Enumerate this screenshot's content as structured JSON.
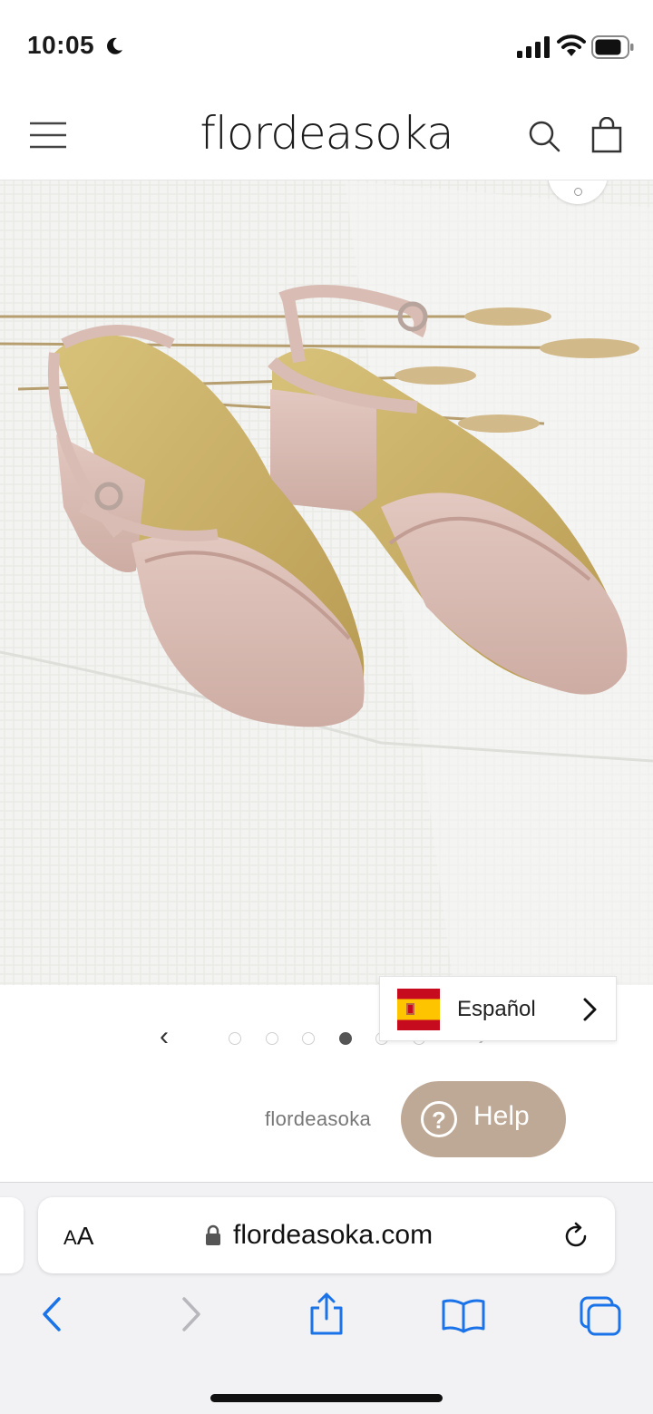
{
  "status_bar": {
    "time": "10:05"
  },
  "header": {
    "brand": "flordeasoka"
  },
  "product": {
    "image_alt": "Pink suede block-heel sandals with ankle straps on a white woven blanket with wheat stalks",
    "carousel": {
      "total_dots": 6,
      "active_index": 3
    }
  },
  "language_selector": {
    "label": "Español"
  },
  "vendor": {
    "name": "flordeasoka"
  },
  "help": {
    "label": "Help",
    "symbol": "?"
  },
  "browser": {
    "text_size_label": "AA",
    "url": "flordeasoka.com"
  },
  "colors": {
    "help_button": "#bea896",
    "ios_blue": "#1a73e8",
    "sandal_pink": "#dcbfb6",
    "blanket": "#eeeeeb"
  }
}
